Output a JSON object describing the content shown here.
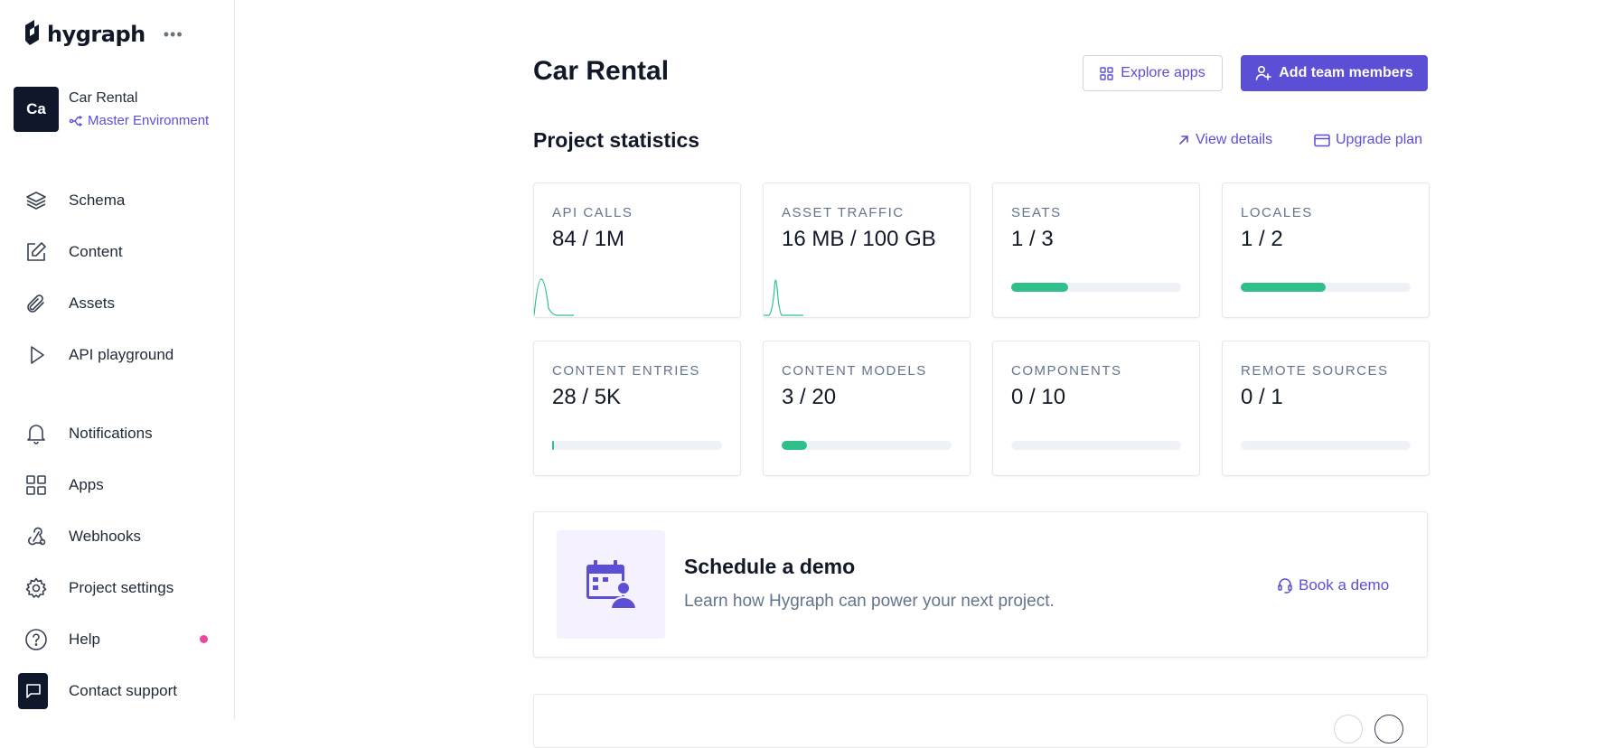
{
  "sidebar": {
    "logo_text": "hygraph",
    "more_label": "•••",
    "project": {
      "avatar": "Ca",
      "name": "Car Rental",
      "environment": "Master Environment"
    },
    "items_top": [
      {
        "label": "Schema",
        "icon": "layers-icon"
      },
      {
        "label": "Content",
        "icon": "edit-icon"
      },
      {
        "label": "Assets",
        "icon": "paperclip-icon"
      },
      {
        "label": "API playground",
        "icon": "play-icon"
      }
    ],
    "items_bottom": [
      {
        "label": "Notifications",
        "icon": "bell-icon"
      },
      {
        "label": "Apps",
        "icon": "grid-icon"
      },
      {
        "label": "Webhooks",
        "icon": "webhook-icon"
      },
      {
        "label": "Project settings",
        "icon": "gear-icon"
      },
      {
        "label": "Help",
        "icon": "help-circle-icon"
      },
      {
        "label": "Contact support",
        "icon": "chat-icon"
      }
    ]
  },
  "header": {
    "title": "Car Rental",
    "explore_label": "Explore apps",
    "add_members_label": "Add team members"
  },
  "stats": {
    "title": "Project statistics",
    "view_details": "View details",
    "upgrade_plan": "Upgrade plan",
    "cards": [
      {
        "label": "API CALLS",
        "value": "84 / 1M",
        "kind": "sparkline"
      },
      {
        "label": "ASSET TRAFFIC",
        "value": "16 MB / 100 GB",
        "kind": "sparkline"
      },
      {
        "label": "SEATS",
        "value": "1 / 3",
        "kind": "bar",
        "fraction": 0.333
      },
      {
        "label": "LOCALES",
        "value": "1 / 2",
        "kind": "bar",
        "fraction": 0.5
      },
      {
        "label": "CONTENT ENTRIES",
        "value": "28 / 5K",
        "kind": "bar",
        "fraction": 0.0056
      },
      {
        "label": "CONTENT MODELS",
        "value": "3 / 20",
        "kind": "bar",
        "fraction": 0.15
      },
      {
        "label": "COMPONENTS",
        "value": "0 / 10",
        "kind": "bar",
        "fraction": 0
      },
      {
        "label": "REMOTE SOURCES",
        "value": "0 / 1",
        "kind": "bar",
        "fraction": 0
      }
    ]
  },
  "demo": {
    "title": "Schedule a demo",
    "subtitle": "Learn how Hygraph can power your next project.",
    "link": "Book a demo"
  },
  "colors": {
    "accent": "#5b4fd6",
    "success": "#2fbf8a",
    "help_dot": "#ec4899"
  }
}
